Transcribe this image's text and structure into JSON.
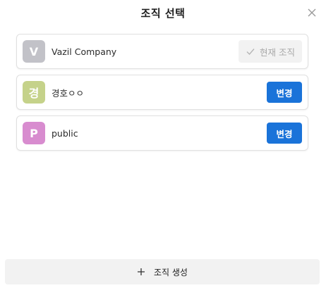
{
  "dialog": {
    "title": "조직 선택"
  },
  "orgs": [
    {
      "initial": "V",
      "name": "Vazil Company",
      "avatar_color": "#c2c2c8",
      "is_current": true,
      "action_label": "현재 조직"
    },
    {
      "initial": "경",
      "name": "경호ㅇㅇ",
      "avatar_color": "#c5d28a",
      "is_current": false,
      "action_label": "변경"
    },
    {
      "initial": "P",
      "name": "public",
      "avatar_color": "#d88ccf",
      "is_current": false,
      "action_label": "변경"
    }
  ],
  "footer": {
    "create_label": "조직 생성"
  },
  "colors": {
    "primary": "#1a73d9",
    "disabled_bg": "#f2f2f2",
    "disabled_text": "#a8a8a8"
  },
  "icons": {
    "close": "close-icon",
    "check": "check-icon",
    "plus": "plus-icon"
  }
}
